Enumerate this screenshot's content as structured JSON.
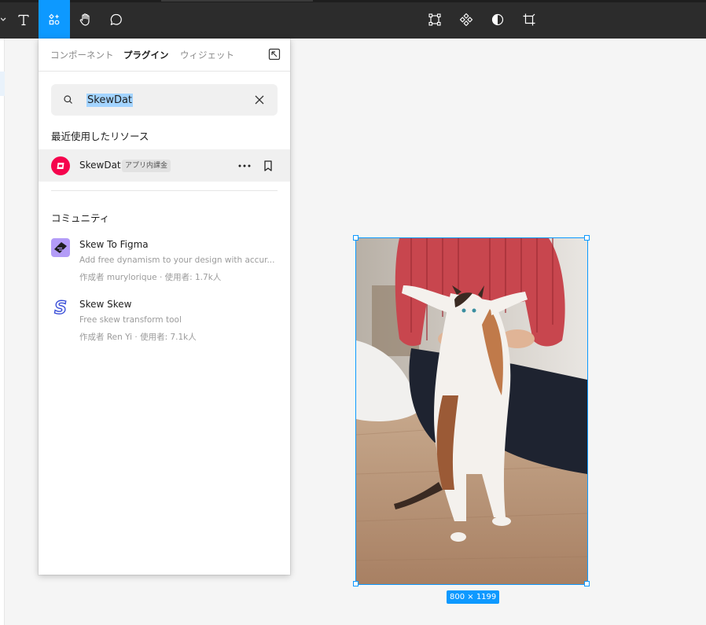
{
  "toolbar": {
    "left_tools": [
      "text-tool",
      "resources-tool",
      "hand-tool",
      "comment-tool"
    ],
    "right_tools": [
      "frame-selection-tool",
      "component-tool",
      "mask-tool",
      "crop-tool"
    ],
    "accent": "#0d99ff"
  },
  "panel": {
    "tabs": [
      {
        "label": "コンポーネント",
        "active": false
      },
      {
        "label": "プラグイン",
        "active": true
      },
      {
        "label": "ウィジェット",
        "active": false
      }
    ],
    "search": {
      "value": "SkewDat"
    },
    "recent": {
      "title": "最近使用したリソース",
      "item": {
        "name": "SkewDat",
        "badge": "アプリ内課金",
        "logo_color": "#f5044d"
      }
    },
    "community": {
      "title": "コミュニティ",
      "items": [
        {
          "name": "Skew To Figma",
          "description": "Add free dynamism to your design with accur...",
          "meta": "作成者 murylorique · 使用者: 1.7k人",
          "logo_color": "#b39cf7"
        },
        {
          "name": "Skew Skew",
          "description": "Free skew transform tool",
          "meta": "作成者 Ren Yi · 使用者: 7.1k人",
          "logo_color": "#3a4fd8"
        }
      ]
    }
  },
  "canvas": {
    "frame_size_label": "800 × 1199",
    "selection_color": "#0d99ff"
  }
}
